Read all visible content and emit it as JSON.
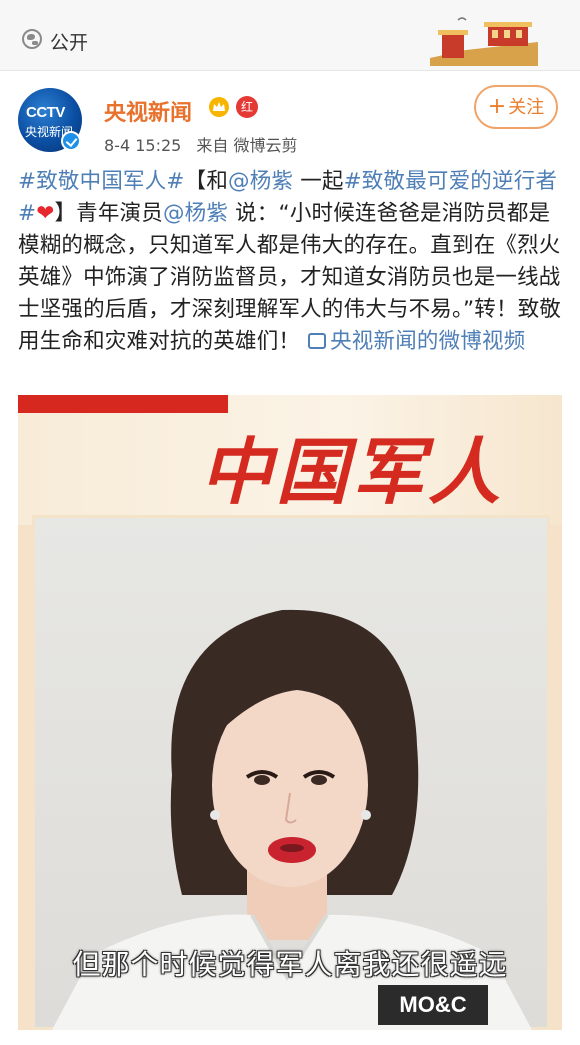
{
  "header": {
    "visibility_label": "公开",
    "visibility_icon": "globe-icon",
    "decoration": "great-wall-banner"
  },
  "author": {
    "avatar_text_logo": "CCTV",
    "avatar_text_name": "央视新闻",
    "name": "央视新闻",
    "badge_text": "红",
    "verified_icon": "verified-check-icon",
    "crown_icon": "crown-icon"
  },
  "meta": {
    "date": "8-4 15:25",
    "source": "来自 微博云剪"
  },
  "follow_button": {
    "plus": "+",
    "label": "关注"
  },
  "post": {
    "tag1": "#致敬中国军人#",
    "bracket_open": "【和",
    "mention1": "@杨紫",
    "together": " 一起",
    "tag2_start": "#致敬最可爱的逆行者#",
    "heart": "❤",
    "bracket_close": "】青年演员",
    "mention2": "@杨紫",
    "body": " 说：“小时候连爸爸是消防员都是模糊的概念，只知道军人都是伟大的存在。直到在《烈火英雄》中饰演了消防监督员，才知道女消防员也是一线战士坚强的后盾，才深刻理解军人的伟大与不易。”转！致敬用生命和灾难对抗的英雄们！",
    "video_link": "央视新闻的微博视频"
  },
  "video": {
    "poster_title": "中国军人",
    "subtitle": "但那个时候觉得军人离我还很遥远",
    "shirt_text": "MO&C"
  },
  "colors": {
    "accent_orange": "#e8722c",
    "link_blue": "#4f7fb7",
    "poster_red": "#d42a1f"
  }
}
